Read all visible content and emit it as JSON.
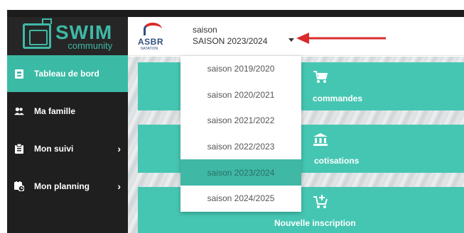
{
  "colors": {
    "accent": "#3bbaa5",
    "sidebar_bg": "#1f1f1f",
    "arrow": "#d92b2b"
  },
  "logo": {
    "title": "SWIM",
    "subtitle": "community"
  },
  "club_logo": {
    "text": "ASBR",
    "sub": "NATATION"
  },
  "sidebar": {
    "items": [
      {
        "label": "Tableau de bord",
        "icon": "dashboard-icon",
        "active": true
      },
      {
        "label": "Ma famille",
        "icon": "family-icon"
      },
      {
        "label": "Mon suivi",
        "icon": "clipboard-icon",
        "chevron": "›"
      },
      {
        "label": "Mon planning",
        "icon": "calendar-clock-icon",
        "chevron": "›"
      }
    ]
  },
  "season": {
    "label": "saison",
    "selected": "SAISON 2023/2024",
    "options": [
      "saison 2019/2020",
      "saison 2020/2021",
      "saison 2021/2022",
      "saison 2022/2023",
      "saison 2023/2024",
      "saison 2024/2025"
    ],
    "selected_index": 4
  },
  "tiles": [
    {
      "label": "commandes",
      "icon": "cart-icon"
    },
    {
      "label": "cotisations",
      "icon": "bank-icon"
    },
    {
      "label": "Nouvelle inscription",
      "icon": "cart-add-icon"
    }
  ]
}
